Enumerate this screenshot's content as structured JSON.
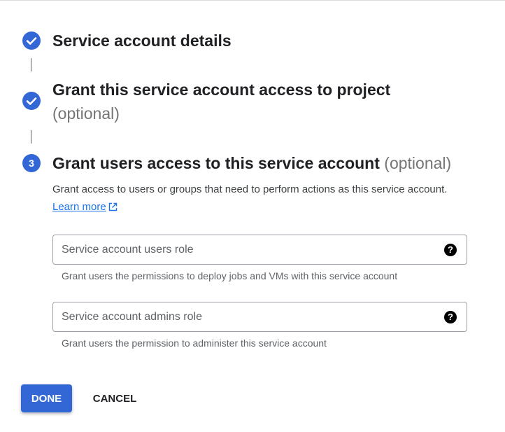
{
  "steps": [
    {
      "number": "1",
      "state": "completed",
      "icon": "check-icon",
      "title": "Service account details"
    },
    {
      "number": "2",
      "state": "completed",
      "icon": "check-icon",
      "title": "Grant this service account access to project",
      "optional": "(optional)"
    },
    {
      "number": "3",
      "state": "active",
      "title": "Grant users access to this service account",
      "optional": "(optional)"
    }
  ],
  "description": {
    "text": "Grant access to users or groups that need to perform actions as this service account.",
    "learn_more": "Learn more"
  },
  "fields": [
    {
      "placeholder": "Service account users role",
      "value": "",
      "hint": "Grant users the permissions to deploy jobs and VMs with this service account",
      "icon": "help-icon"
    },
    {
      "placeholder": "Service account admins role",
      "value": "",
      "hint": "Grant users the permission to administer this service account",
      "icon": "help-icon"
    }
  ],
  "buttons": {
    "done": "DONE",
    "cancel": "CANCEL"
  },
  "colors": {
    "accent": "#3367d6",
    "link": "#1a73e8",
    "optional_text": "#757575"
  }
}
